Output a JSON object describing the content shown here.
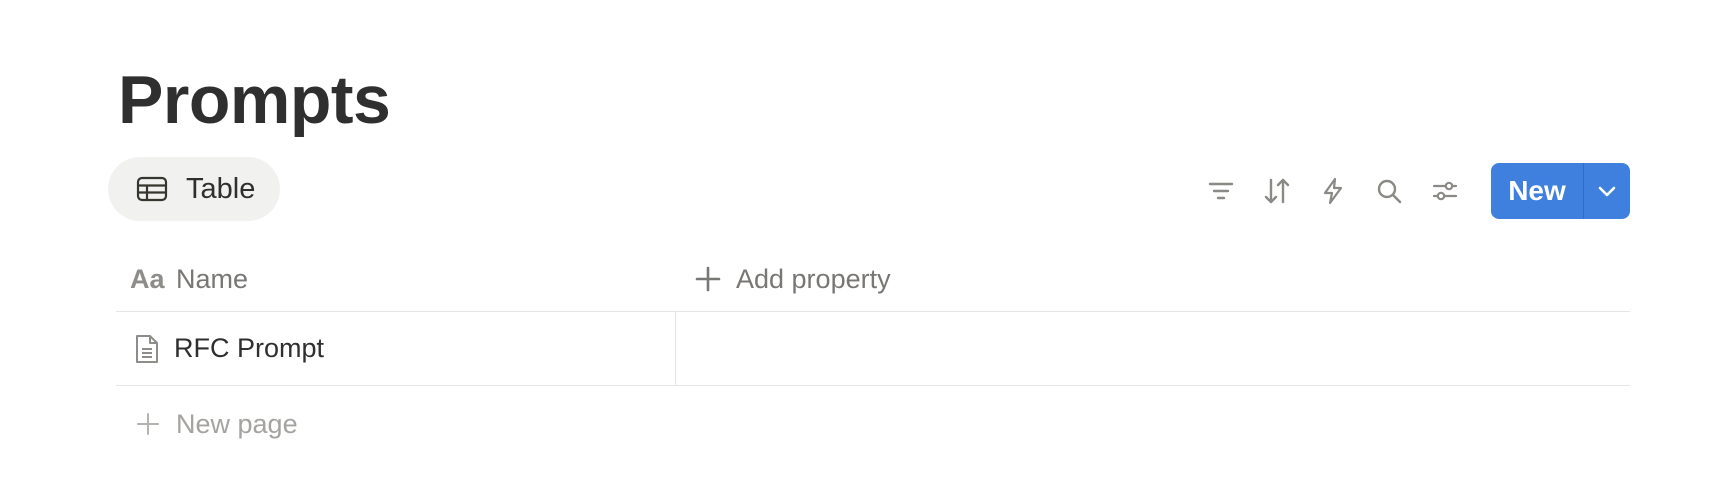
{
  "page": {
    "title": "Prompts"
  },
  "view": {
    "tab_label": "Table",
    "icon": "table-icon"
  },
  "toolbar": {
    "tools": [
      {
        "name": "filter",
        "icon": "filter-icon"
      },
      {
        "name": "sort",
        "icon": "sort-icon"
      },
      {
        "name": "automation",
        "icon": "lightning-icon"
      },
      {
        "name": "search",
        "icon": "search-icon"
      },
      {
        "name": "settings",
        "icon": "sliders-icon"
      }
    ],
    "new_label": "New",
    "accent": "#3f80de"
  },
  "table": {
    "columns": [
      {
        "label": "Name",
        "icon": "text-type-icon",
        "icon_text": "Aa"
      }
    ],
    "add_property_label": "Add property",
    "rows": [
      {
        "name": "RFC Prompt",
        "icon": "page-icon"
      }
    ],
    "new_page_label": "New page"
  }
}
